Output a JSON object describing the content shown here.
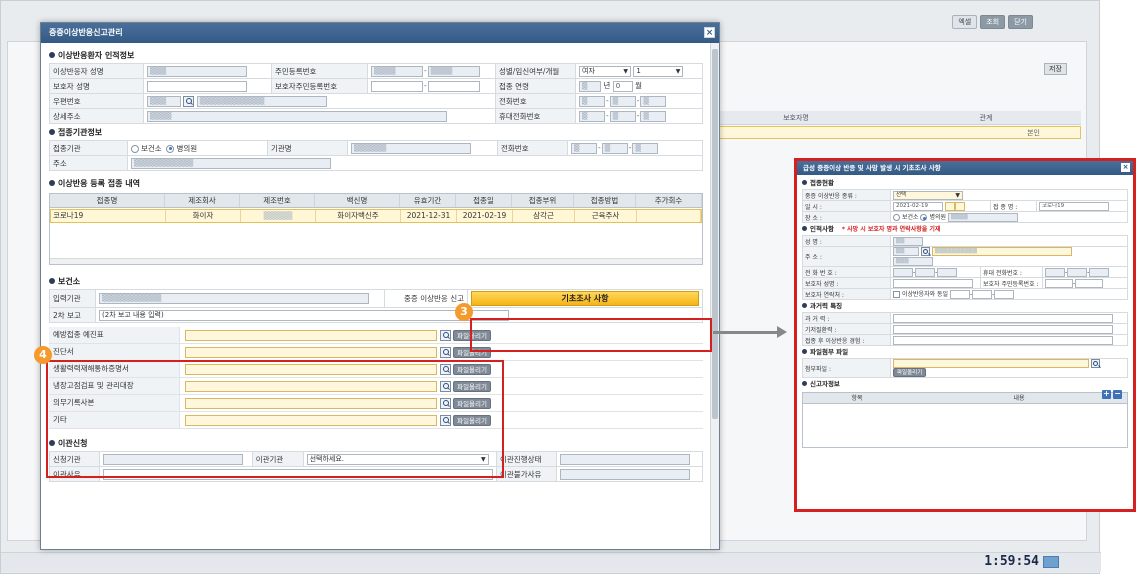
{
  "background": {
    "top_buttons": [
      "엑셀",
      "조회",
      "닫기"
    ],
    "right_button": "저장",
    "grid_headers": [
      "보호자명",
      "관계"
    ],
    "grid_row_value": "본인",
    "clock": "1:59:54"
  },
  "dialog": {
    "title": "중증이상반응신고관리",
    "sections": {
      "personal": "이상반응환자 인적정보",
      "institution": "접종기관정보",
      "vaccination": "이상반응 등록 접종 내역",
      "health_center": "보건소",
      "transfer": "이관신청"
    },
    "personal": {
      "name_label": "이상반응자 성명",
      "rrn_label": "주민등록번호",
      "gender_label": "성별/임신여부/개월",
      "gender_value": "여자",
      "pregnancy_value": "1",
      "guardian_label": "보호자 성명",
      "guardian_rrn_label": "보호자주민등록번호",
      "age_label": "접종 연령",
      "age_year_unit": "년",
      "age_month_value": "0",
      "age_month_unit": "월",
      "postal_label": "우편번호",
      "phone_label": "전화번호",
      "address_label": "상세주소",
      "mobile_label": "휴대전화번호"
    },
    "institution": {
      "type_label": "접종기관",
      "option_health_center": "보건소",
      "option_clinic": "병의원",
      "org_name_label": "기관명",
      "phone_label": "전화번호",
      "address_label": "주소"
    },
    "vaccination": {
      "headers": [
        "접종명",
        "제조회사",
        "제조번호",
        "백신명",
        "유효기간",
        "접종일",
        "접종부위",
        "접종방법",
        "추가회수"
      ],
      "row": [
        "코로나19",
        "화이자",
        "",
        "화이자백신주",
        "2021-12-31",
        "2021-02-19",
        "삼각근",
        "근육주사",
        ""
      ]
    },
    "health_center": {
      "input_org_label": "입력기관",
      "report_label": "중증 이상반응 신고",
      "report_button": "기초조사 사항",
      "second_report_label": "2차 보고",
      "second_report_value": "(2차 보고 내용 입력)",
      "attachments": [
        {
          "label": "예방접종 예진표"
        },
        {
          "label": "진단서"
        },
        {
          "label": "생활력력재해통하증명서"
        },
        {
          "label": "냉장고점검표 및 관리대장"
        },
        {
          "label": "의무기록사본"
        },
        {
          "label": "기타"
        }
      ],
      "upload_label": "파일올리기"
    },
    "transfer": {
      "request_org_label": "신청기관",
      "target_org_label": "이관기관",
      "target_org_placeholder": "선택하세요.",
      "status_label": "이관진행상태",
      "reason_label": "이관사유",
      "deny_reason_label": "이관불가사유"
    }
  },
  "callouts": {
    "badge_3": "3",
    "badge_4": "4"
  },
  "dialog2": {
    "title": "급성 중증이상 반응 및 사망 발생 시 기초조사 사항",
    "sections": {
      "vaccination": "접종현황",
      "personal": "인적사항",
      "history": "과거력 특징",
      "attachment": "파일첨부 파일",
      "reporter": "신고자정보"
    },
    "vaccination": {
      "type_label": "중증 이상반응 종류 :",
      "type_value": "선택",
      "datetime_label": "일    시 :",
      "date_value": "2021-02-19",
      "vaccine_label": "접 종 명 :",
      "vaccine_value": "코로나19",
      "place_label": "장    소 :",
      "option_health_center": "보건소",
      "option_clinic": "병의원"
    },
    "personal": {
      "note": "* 사망 시 보호자 명과 연락사항을 기재",
      "name_label": "성    명 :",
      "address_label": "주    소 :",
      "phone_label": "전 화 번 호 :",
      "mobile_label": "휴대 전화번호 :",
      "guardian_label": "보호자 성명 :",
      "guardian_rrn_label": "보호자 주민등록번호 :",
      "guardian_contact_label": "보호자 연락처 :",
      "same_checkbox_label": "이상반응자와 동일"
    },
    "history": {
      "past_label": "과 거 력 :",
      "allergy_label": "기저질환력 :",
      "after_label": "접종 후 이상반응 경험 :"
    },
    "attachment": {
      "file_label": "첨부파일 :",
      "upload_label": "파일올리기"
    },
    "reporter": {
      "headers": [
        "항목",
        "내용"
      ]
    }
  }
}
